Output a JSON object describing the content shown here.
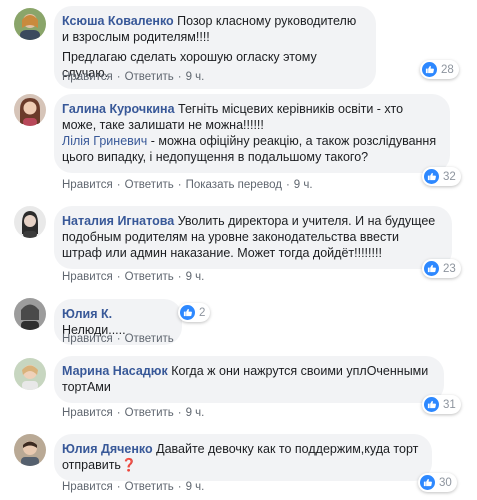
{
  "actions": {
    "like": "Нравится",
    "reply": "Ответить",
    "translate": "Показать перевод",
    "sep": "·"
  },
  "comments": [
    {
      "author": "Ксюша Коваленко",
      "text1": "Позор класному руководителю и взрослым родителям!!!!",
      "text2": "Предлагаю сделать хорошую огласку этому случаю.",
      "time": "9 ч.",
      "reactions": "28"
    },
    {
      "author": "Галина Курочкина",
      "text1": "Тегніть місцевих керівників освіти - хто може, таке залишати не можна!!!!!!",
      "mention": "Лілія Гриневич",
      "text2": " - можна офіційну реакцію, а також розслідування цього випадку, і недопущення в подальшому такого?",
      "time": "9 ч.",
      "reactions": "32"
    },
    {
      "author": "Наталия Игнатова",
      "text1": "Уволить директора и учителя. И на будущее подобным родителям на уровне законодательства ввести штраф или админ наказание. Может тогда дойдёт!!!!!!!!",
      "time": "9 ч.",
      "reactions": "23"
    },
    {
      "author": "Юлия К.",
      "text1": "Нелюди.....",
      "reactions": "2"
    },
    {
      "author": "Марина Насадюк",
      "text1": "Когда ж они нажрутся своими уплОченными тортАми",
      "time": "9 ч.",
      "reactions": "31"
    },
    {
      "author": "Юлия Дяченко",
      "text1": "Давайте девочку как то поддержим,куда торт отправить",
      "qmark": "❓",
      "time": "9 ч.",
      "reactions": "30"
    }
  ]
}
